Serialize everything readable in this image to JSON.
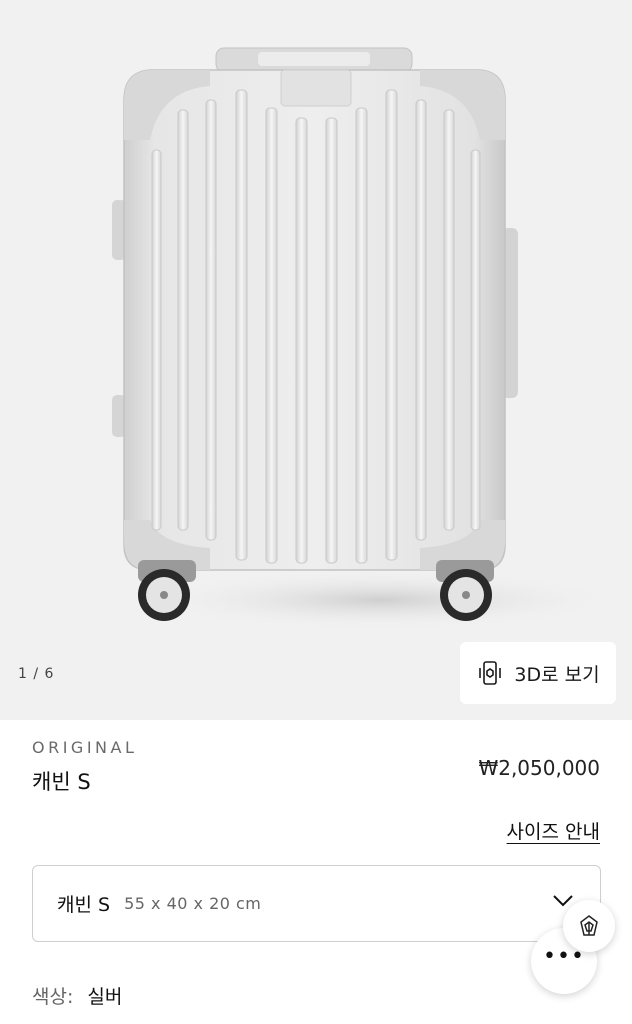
{
  "gallery": {
    "counter": "1 / 6",
    "view_3d_label": "3D로 보기",
    "image_alt_icon": "suitcase-image"
  },
  "product": {
    "collection": "ORIGINAL",
    "name": "캐빈 S",
    "price": "₩2,050,000",
    "size_guide": "사이즈 안내"
  },
  "size_select": {
    "selected_name": "캐빈 S",
    "selected_dims": "55 x 40 x 20 cm"
  },
  "color": {
    "label": "색상:",
    "value": "실버"
  },
  "floating": {
    "chat_icon": "more-dots-icon",
    "brand_icon": "brand-logo-icon"
  }
}
